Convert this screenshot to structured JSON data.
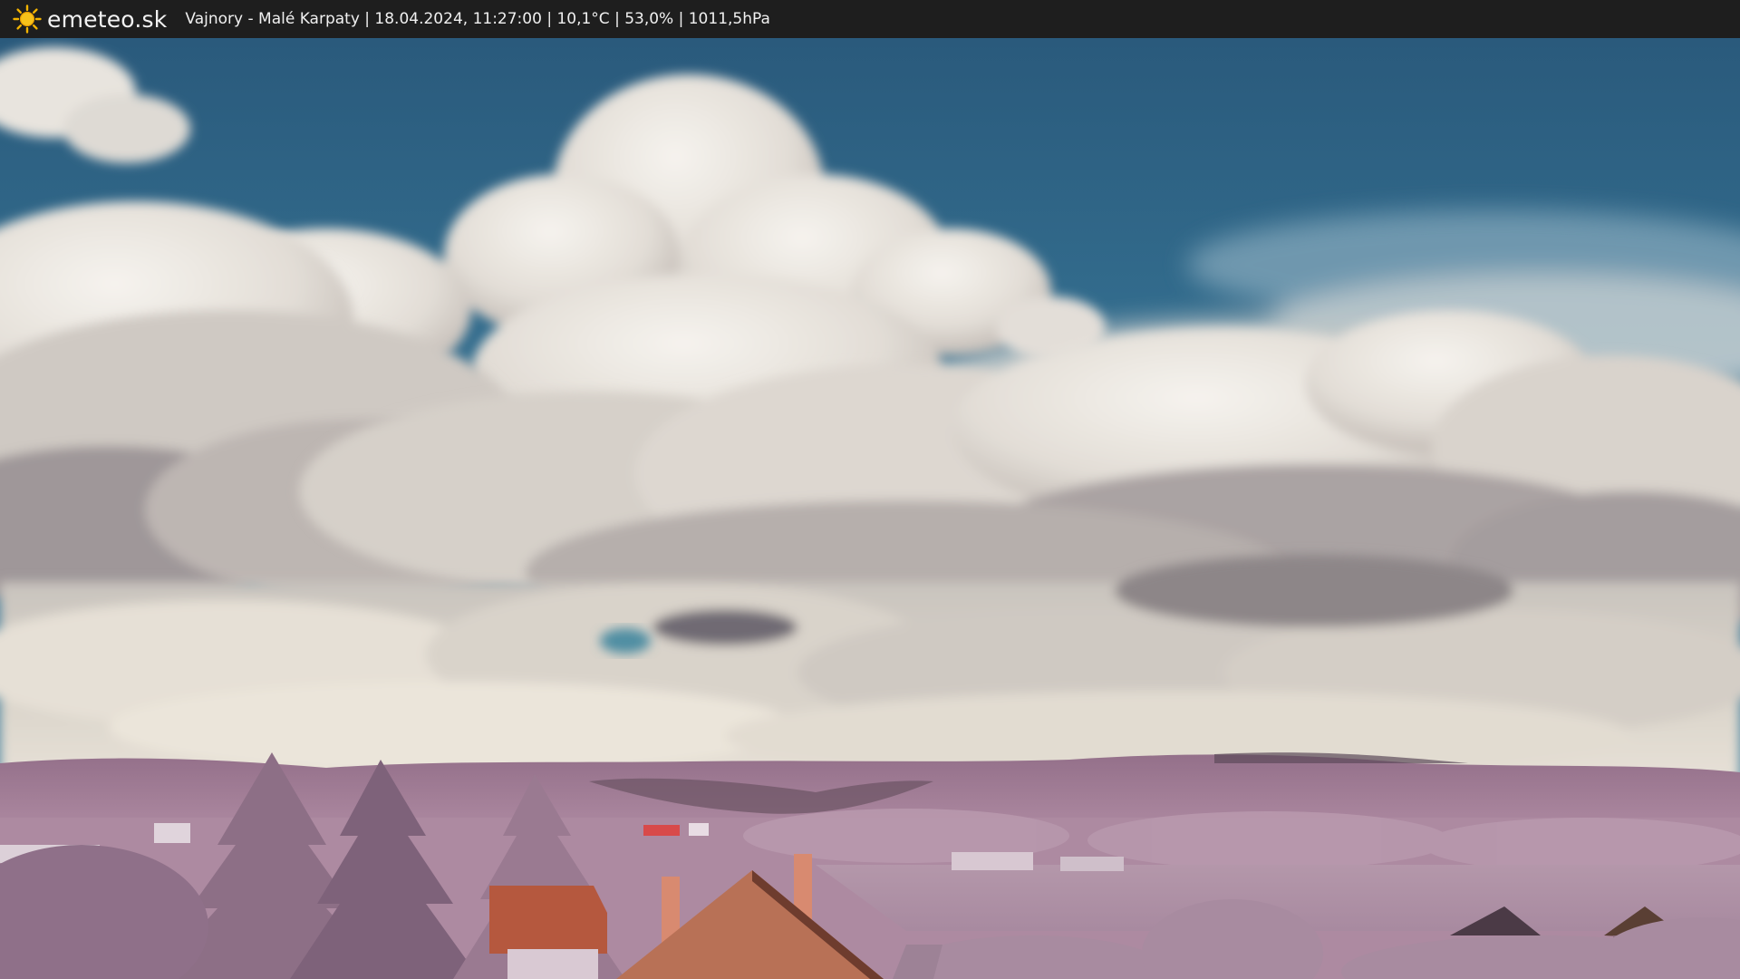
{
  "header": {
    "logo_text": "emeteo.sk",
    "logo_icon": "sun-icon",
    "status": "Vajnory - Malé Karpaty | 18.04.2024, 11:27:00 | 10,1°C | 53,0% | 1011,5hPa"
  },
  "image": {
    "icon": "webcam-image",
    "colors": {
      "sky": "#2e6384",
      "cloud": "#e6e2dc",
      "hills": "#a77f97",
      "vegetation": "#b08aa2",
      "roof": "#b06040"
    }
  }
}
